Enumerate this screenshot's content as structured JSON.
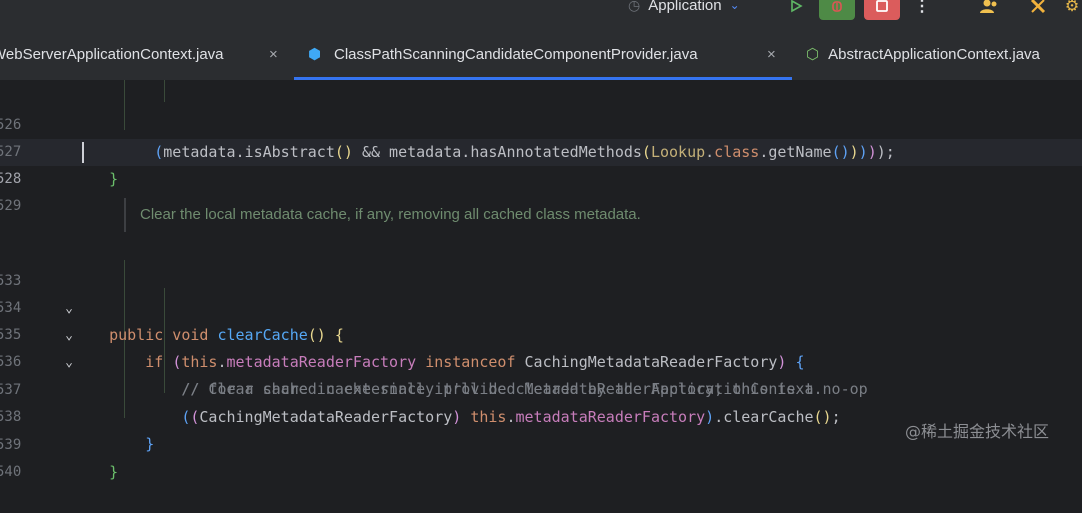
{
  "toolbar": {
    "run_config": "Application",
    "icons": {
      "clock": "clock-icon",
      "chevron": "chevron-down-icon",
      "run": "run-icon",
      "debug": "debug-icon",
      "stop": "stop-icon",
      "more": "more-vertical-icon",
      "people": "people-icon",
      "tools": "tools-icon"
    }
  },
  "tabs": [
    {
      "label": "WebServerApplicationContext.java",
      "active": false
    },
    {
      "label": "ClassPathScanningCandidateComponentProvider.java",
      "active": true
    },
    {
      "label": "AbstractApplicationContext.java",
      "active": false
    }
  ],
  "editor": {
    "line_numbers": [
      "526",
      "527",
      "528",
      "529",
      "533",
      "534",
      "535",
      "536",
      "537",
      "538",
      "539",
      "540"
    ],
    "doc_comment": "Clear the local metadata cache, if any, removing all cached class metadata.",
    "comments": [
      "// Clear cache in externally provided MetadataReaderFactory; this is a no-op",
      "// for a shared cache since it'll be cleared by the ApplicationContext."
    ],
    "method_name": "clearCache",
    "field_name": "metadataReaderFactory",
    "class_name": "CachingMetadataReaderFactory",
    "current_line": "528"
  },
  "colors": {
    "background": "#1e1f22",
    "keyword": "#cf8e6d",
    "function": "#56a8f5",
    "field": "#c77dbb",
    "accent": "#3574f0"
  },
  "watermark": "@稀土掘金技术社区"
}
